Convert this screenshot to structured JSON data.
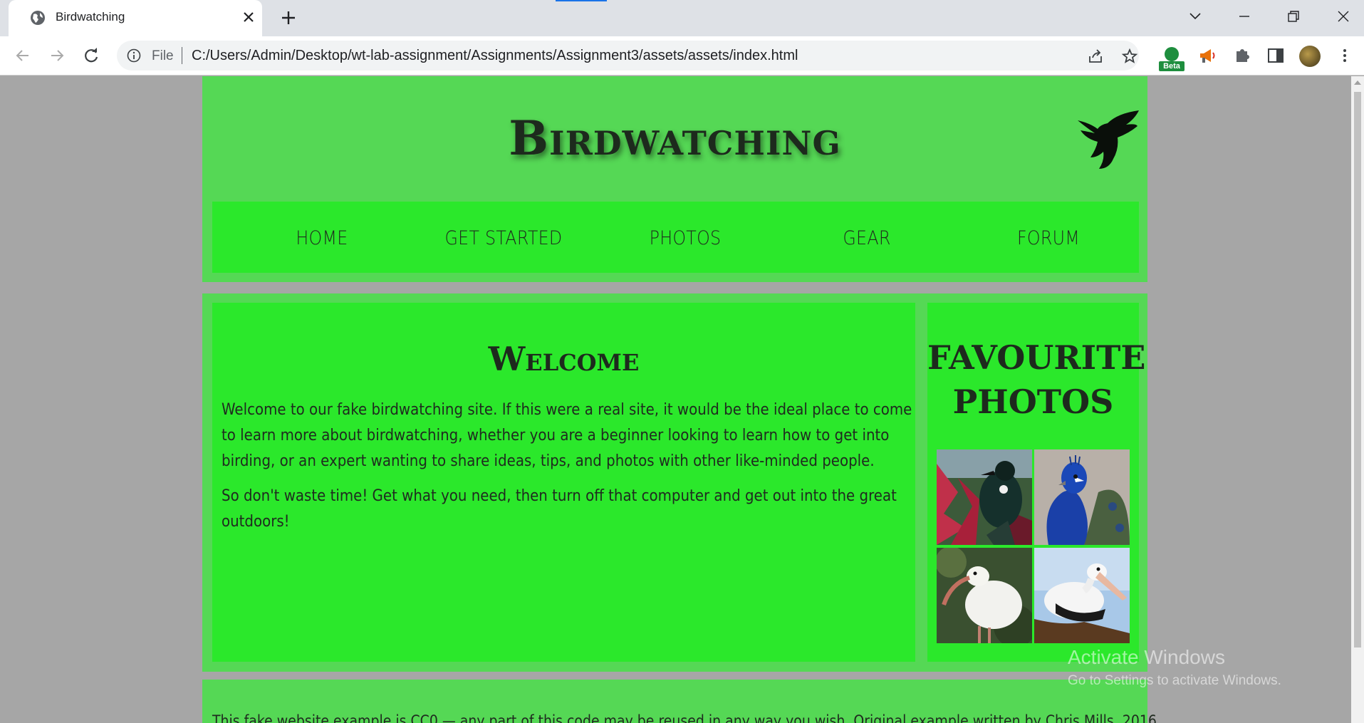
{
  "browser": {
    "tab_title": "Birdwatching",
    "omnibox_scheme": "File",
    "url": "C:/Users/Admin/Desktop/wt-lab-assignment/Assignments/Assignment3/assets/assets/index.html",
    "beta_badge": "Beta",
    "icons": [
      "globe-icon",
      "close-icon",
      "plus-icon",
      "chevron-down-icon",
      "minimize-icon",
      "restore-icon",
      "window-close-icon",
      "back-icon",
      "forward-icon",
      "reload-icon",
      "info-icon",
      "share-icon",
      "star-icon",
      "megaphone-icon",
      "puzzle-icon",
      "side-panel-icon",
      "avatar",
      "kebab-menu-icon"
    ],
    "accent_color": "#1a73e8"
  },
  "site": {
    "title": "Birdwatching",
    "nav": [
      "HOME",
      "GET STARTED",
      "PHOTOS",
      "GEAR",
      "FORUM"
    ],
    "welcome_heading": "Welcome",
    "welcome_p1": "Welcome to our fake birdwatching site. If this were a real site, it would be the ideal place to come to learn more about birdwatching, whether you are a beginner looking to learn how to get into birding, or an expert wanting to share ideas, tips, and photos with other like-minded people.",
    "welcome_p2": "So don't waste time! Get what you need, then turn off that computer and get out into the great outdoors!",
    "aside_heading": "FAVOURITE PHOTOS",
    "photos": [
      "tui-photo",
      "peacock-photo",
      "ibis-photo",
      "pelican-photo"
    ],
    "footer": "This fake website example is CC0 — any part of this code may be reused in any way you wish. Original example written by Chris Mills, 2016.",
    "colors": {
      "panel": "#55d855",
      "inner": "#2be82b",
      "page_bg": "#a6a6a6",
      "text": "#1d2a1d"
    }
  },
  "os_overlay": {
    "line1": "Activate Windows",
    "line2": "Go to Settings to activate Windows."
  }
}
